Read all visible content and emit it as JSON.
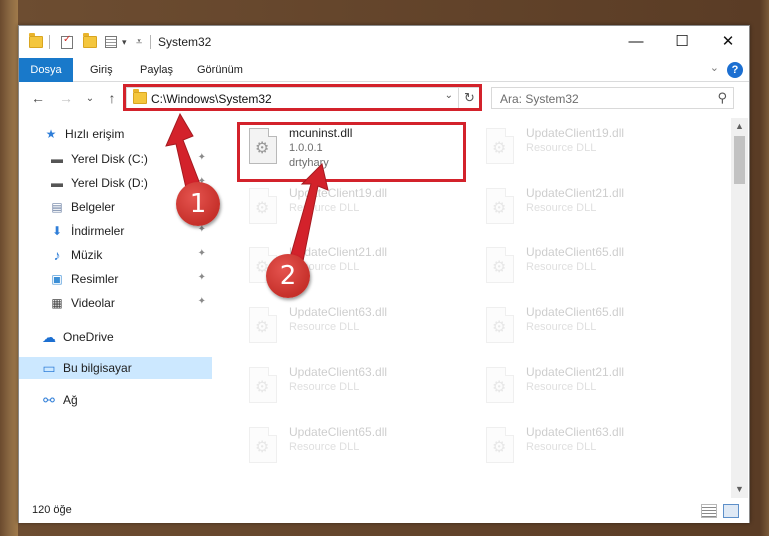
{
  "window": {
    "title": "System32"
  },
  "titlebar": {
    "minimize": "—",
    "maximize": "☐",
    "close": "✕",
    "qa_dropdown": "▾"
  },
  "ribbon": {
    "tabs": [
      {
        "label": "Dosya"
      },
      {
        "label": "Giriş"
      },
      {
        "label": "Paylaş"
      },
      {
        "label": "Görünüm"
      }
    ],
    "help": "?",
    "collapse": "⌄"
  },
  "address": {
    "path": "C:\\Windows\\System32",
    "dropdown": "⌄",
    "refresh": "↻"
  },
  "search": {
    "placeholder": "Ara: System32",
    "icon": "⚲"
  },
  "nav": {
    "back": "←",
    "forward": "→",
    "recent": "⌄",
    "up": "↑",
    "items": [
      {
        "label": "Hızlı erişim",
        "icon": "star-icon",
        "glyph": "★"
      },
      {
        "label": "Yerel Disk (C:)",
        "icon": "drive-icon",
        "glyph": "▬",
        "pinned": true
      },
      {
        "label": "Yerel Disk (D:)",
        "icon": "drive-icon",
        "glyph": "▬",
        "pinned": true
      },
      {
        "label": "Belgeler",
        "icon": "documents-icon",
        "glyph": "▤",
        "pinned": true
      },
      {
        "label": "İndirmeler",
        "icon": "download-icon",
        "glyph": "⬇",
        "pinned": true
      },
      {
        "label": "Müzik",
        "icon": "music-icon",
        "glyph": "♪",
        "pinned": true
      },
      {
        "label": "Resimler",
        "icon": "pictures-icon",
        "glyph": "▣",
        "pinned": true
      },
      {
        "label": "Videolar",
        "icon": "video-icon",
        "glyph": "▦",
        "pinned": true
      },
      {
        "label": "OneDrive",
        "icon": "cloud-icon",
        "glyph": "☁"
      },
      {
        "label": "Bu bilgisayar",
        "icon": "computer-icon",
        "glyph": "▭",
        "selected": true
      },
      {
        "label": "Ağ",
        "icon": "network-icon",
        "glyph": "⚯"
      }
    ],
    "pin_glyph": "📌"
  },
  "files": {
    "left": [
      {
        "name": "mcuninst.dll",
        "line2": "1.0.0.1",
        "line3": "drtyhary"
      },
      {
        "name": "UpdateClient19.dll",
        "line2": "Resource DLL"
      },
      {
        "name": "UpdateClient21.dll",
        "line2": "Resource DLL"
      },
      {
        "name": "UpdateClient63.dll",
        "line2": "Resource DLL"
      },
      {
        "name": "UpdateClient63.dll",
        "line2": "Resource DLL"
      },
      {
        "name": "UpdateClient65.dll",
        "line2": "Resource DLL"
      }
    ],
    "right": [
      {
        "name": "UpdateClient19.dll",
        "line2": "Resource DLL"
      },
      {
        "name": "UpdateClient21.dll",
        "line2": "Resource DLL"
      },
      {
        "name": "UpdateClient65.dll",
        "line2": "Resource DLL"
      },
      {
        "name": "UpdateClient65.dll",
        "line2": "Resource DLL"
      },
      {
        "name": "UpdateClient21.dll",
        "line2": "Resource DLL"
      },
      {
        "name": "UpdateClient63.dll",
        "line2": "Resource DLL"
      }
    ]
  },
  "status": {
    "count": "120 öğe"
  },
  "annotations": {
    "badge1": "1",
    "badge2": "2",
    "color": "#d3222b"
  }
}
